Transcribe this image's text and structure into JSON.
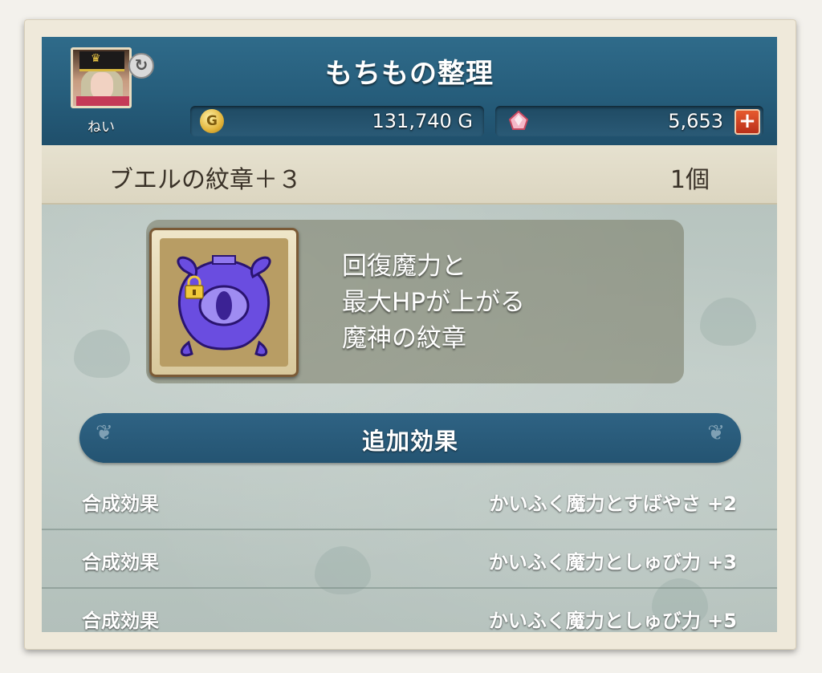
{
  "header": {
    "title": "もちもの整理",
    "username": "ねい",
    "gold": "131,740 G",
    "gold_icon": "G",
    "gems": "5,653",
    "plus_label": "+"
  },
  "item": {
    "name": "ブエルの紋章＋３",
    "count": "1個",
    "description": [
      "回復魔力と",
      "最大HPが上がる",
      "魔神の紋章"
    ]
  },
  "section": {
    "title": "追加効果"
  },
  "effects": [
    {
      "label": "合成効果",
      "value": "かいふく魔力とすばやさ +2"
    },
    {
      "label": "合成効果",
      "value": "かいふく魔力としゅび力 +3"
    },
    {
      "label": "合成効果",
      "value": "かいふく魔力としゅび力 +5"
    }
  ],
  "colors": {
    "header_blue": "#265d7b",
    "panel_bg": "#b9c6c2",
    "item_bar": "#e6e1cf",
    "emblem_purple": "#6a4de0"
  },
  "icons": {
    "coin": "gold-coin-icon",
    "gem": "gem-icon",
    "swap": "swap-character-icon",
    "lock": "lock-icon",
    "emblem": "demon-emblem-icon"
  }
}
